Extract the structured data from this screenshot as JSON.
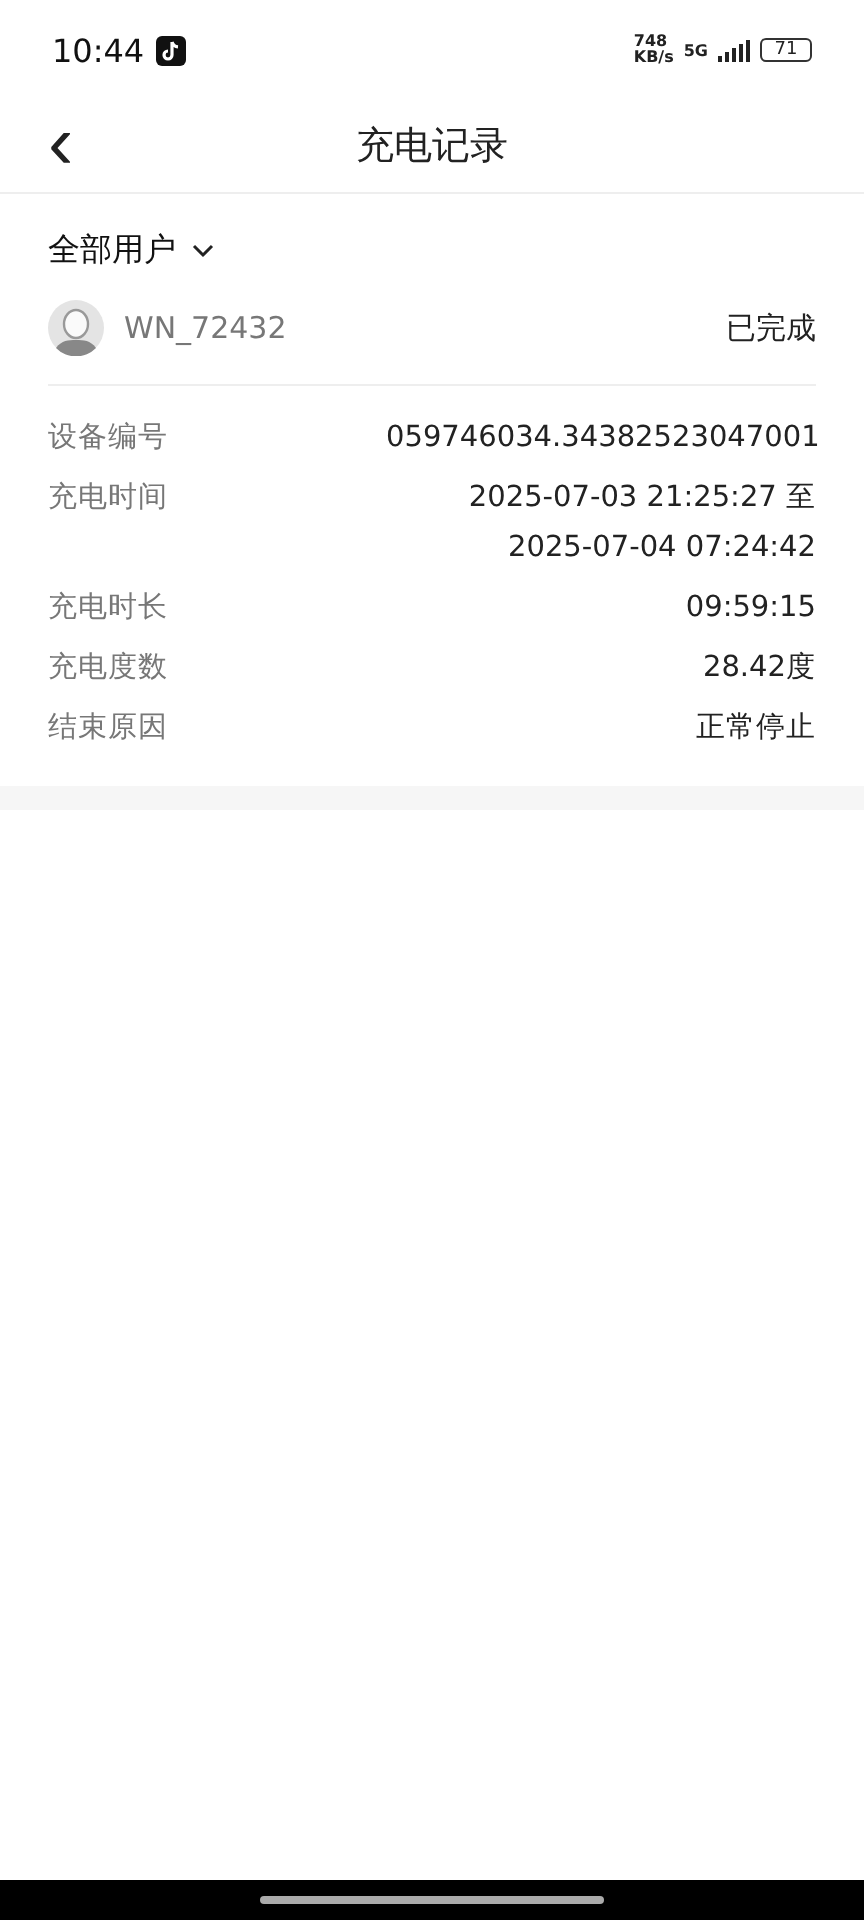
{
  "status_bar": {
    "time": "10:44",
    "speed_value": "748",
    "speed_unit": "KB/s",
    "network": "5G",
    "battery": "71"
  },
  "header": {
    "back": "‹",
    "title": "充电记录"
  },
  "filter": {
    "label": "全部用户"
  },
  "record": {
    "user": "WN_72432",
    "status": "已完成",
    "fields": [
      {
        "label": "设备编号",
        "value": "059746034.34382523047001"
      },
      {
        "label": "充电时间",
        "value": "2025-07-03 21:25:27 至 2025-07-04 07:24:42"
      },
      {
        "label": "充电时长",
        "value": "09:59:15"
      },
      {
        "label": "充电度数",
        "value": "28.42度"
      },
      {
        "label": "结束原因",
        "value": "正常停止"
      }
    ]
  }
}
